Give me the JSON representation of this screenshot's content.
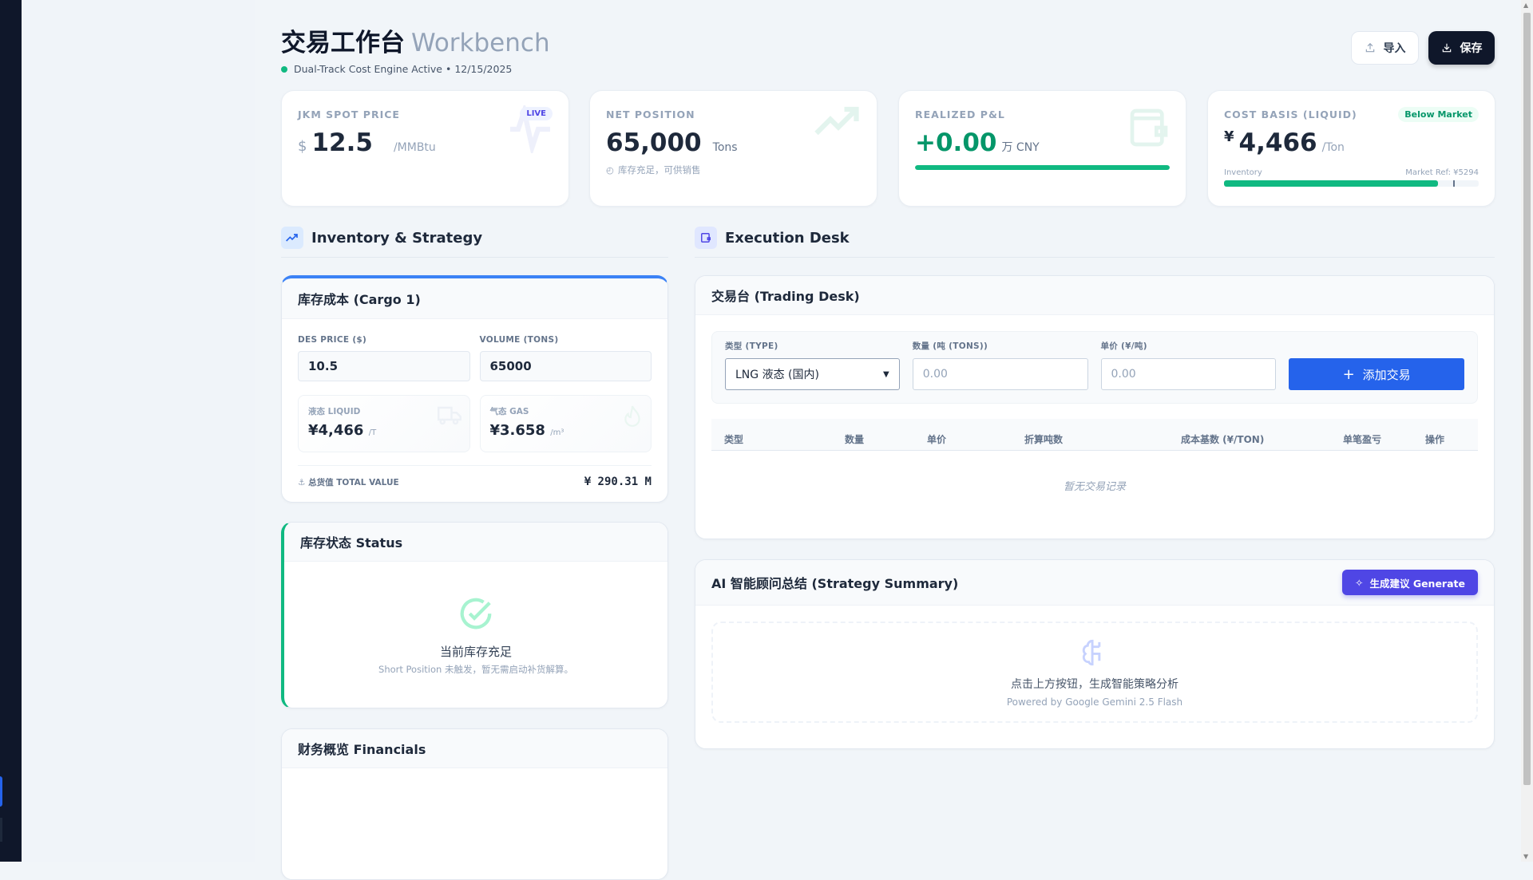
{
  "header": {
    "title": "交易工作台",
    "title_en": "Workbench",
    "status": "Dual-Track Cost Engine Active",
    "date": "12/15/2025",
    "separator": "•",
    "import_label": "导入",
    "save_label": "保存"
  },
  "kpis": {
    "spot": {
      "label": "JKM SPOT PRICE",
      "currency": "$",
      "value": "12.5",
      "unit": "/MMBtu",
      "badge": "LIVE"
    },
    "net": {
      "label": "NET POSITION",
      "value": "65,000",
      "unit": "Tons",
      "note": "库存充足，可供销售"
    },
    "pnl": {
      "label": "REALIZED P&L",
      "value": "+0.00",
      "unit": "万 CNY",
      "progress": 1.0
    },
    "cost": {
      "label": "COST BASIS (LIQUID)",
      "currency": "¥",
      "value": "4,466",
      "unit": "/Ton",
      "badge": "Below Market",
      "bar_left": "Inventory",
      "bar_right": "Market Ref: ¥5294",
      "progress": 0.84,
      "marker": 0.9
    }
  },
  "sections": {
    "left": "Inventory & Strategy",
    "right": "Execution Desk"
  },
  "cargo": {
    "title": "库存成本 (Cargo 1)",
    "price_label": "DES PRICE ($)",
    "price_value": "10.5",
    "volume_label": "VOLUME (TONS)",
    "volume_value": "65000",
    "liquid_label": "液态 LIQUID",
    "liquid_value": "¥4,466",
    "liquid_unit": "/T",
    "gas_label": "气态 GAS",
    "gas_value": "¥3.658",
    "gas_unit": "/m³",
    "total_label": "总货值 TOTAL VALUE",
    "total_value": "¥ 290.31 M"
  },
  "status": {
    "title": "库存状态 Status",
    "headline": "当前库存充足",
    "detail": "Short Position 未触发，暂无需启动补货解算。"
  },
  "financials": {
    "title": "财务概览 Financials"
  },
  "desk": {
    "title": "交易台 (Trading Desk)",
    "type_label": "类型 (TYPE)",
    "type_value": "LNG 液态 (国内)",
    "qty_label": "数量 (吨 (TONS))",
    "qty_placeholder": "0.00",
    "price_label": "单价 (¥/吨)",
    "price_placeholder": "0.00",
    "add_label": "添加交易",
    "columns": [
      "类型",
      "数量",
      "单价",
      "折算吨数",
      "成本基数 (¥/TON)",
      "单笔盈亏",
      "操作"
    ],
    "empty": "暂无交易记录"
  },
  "ai": {
    "title": "AI 智能顾问总结 (Strategy Summary)",
    "button": "生成建议 Generate",
    "prompt": "点击上方按钮，生成智能策略分析",
    "powered": "Powered by Google Gemini 2.5 Flash"
  },
  "colors": {
    "accent": "#2563eb",
    "success": "#10b981",
    "ai": "#4f46e5",
    "dark": "#0f172a"
  }
}
